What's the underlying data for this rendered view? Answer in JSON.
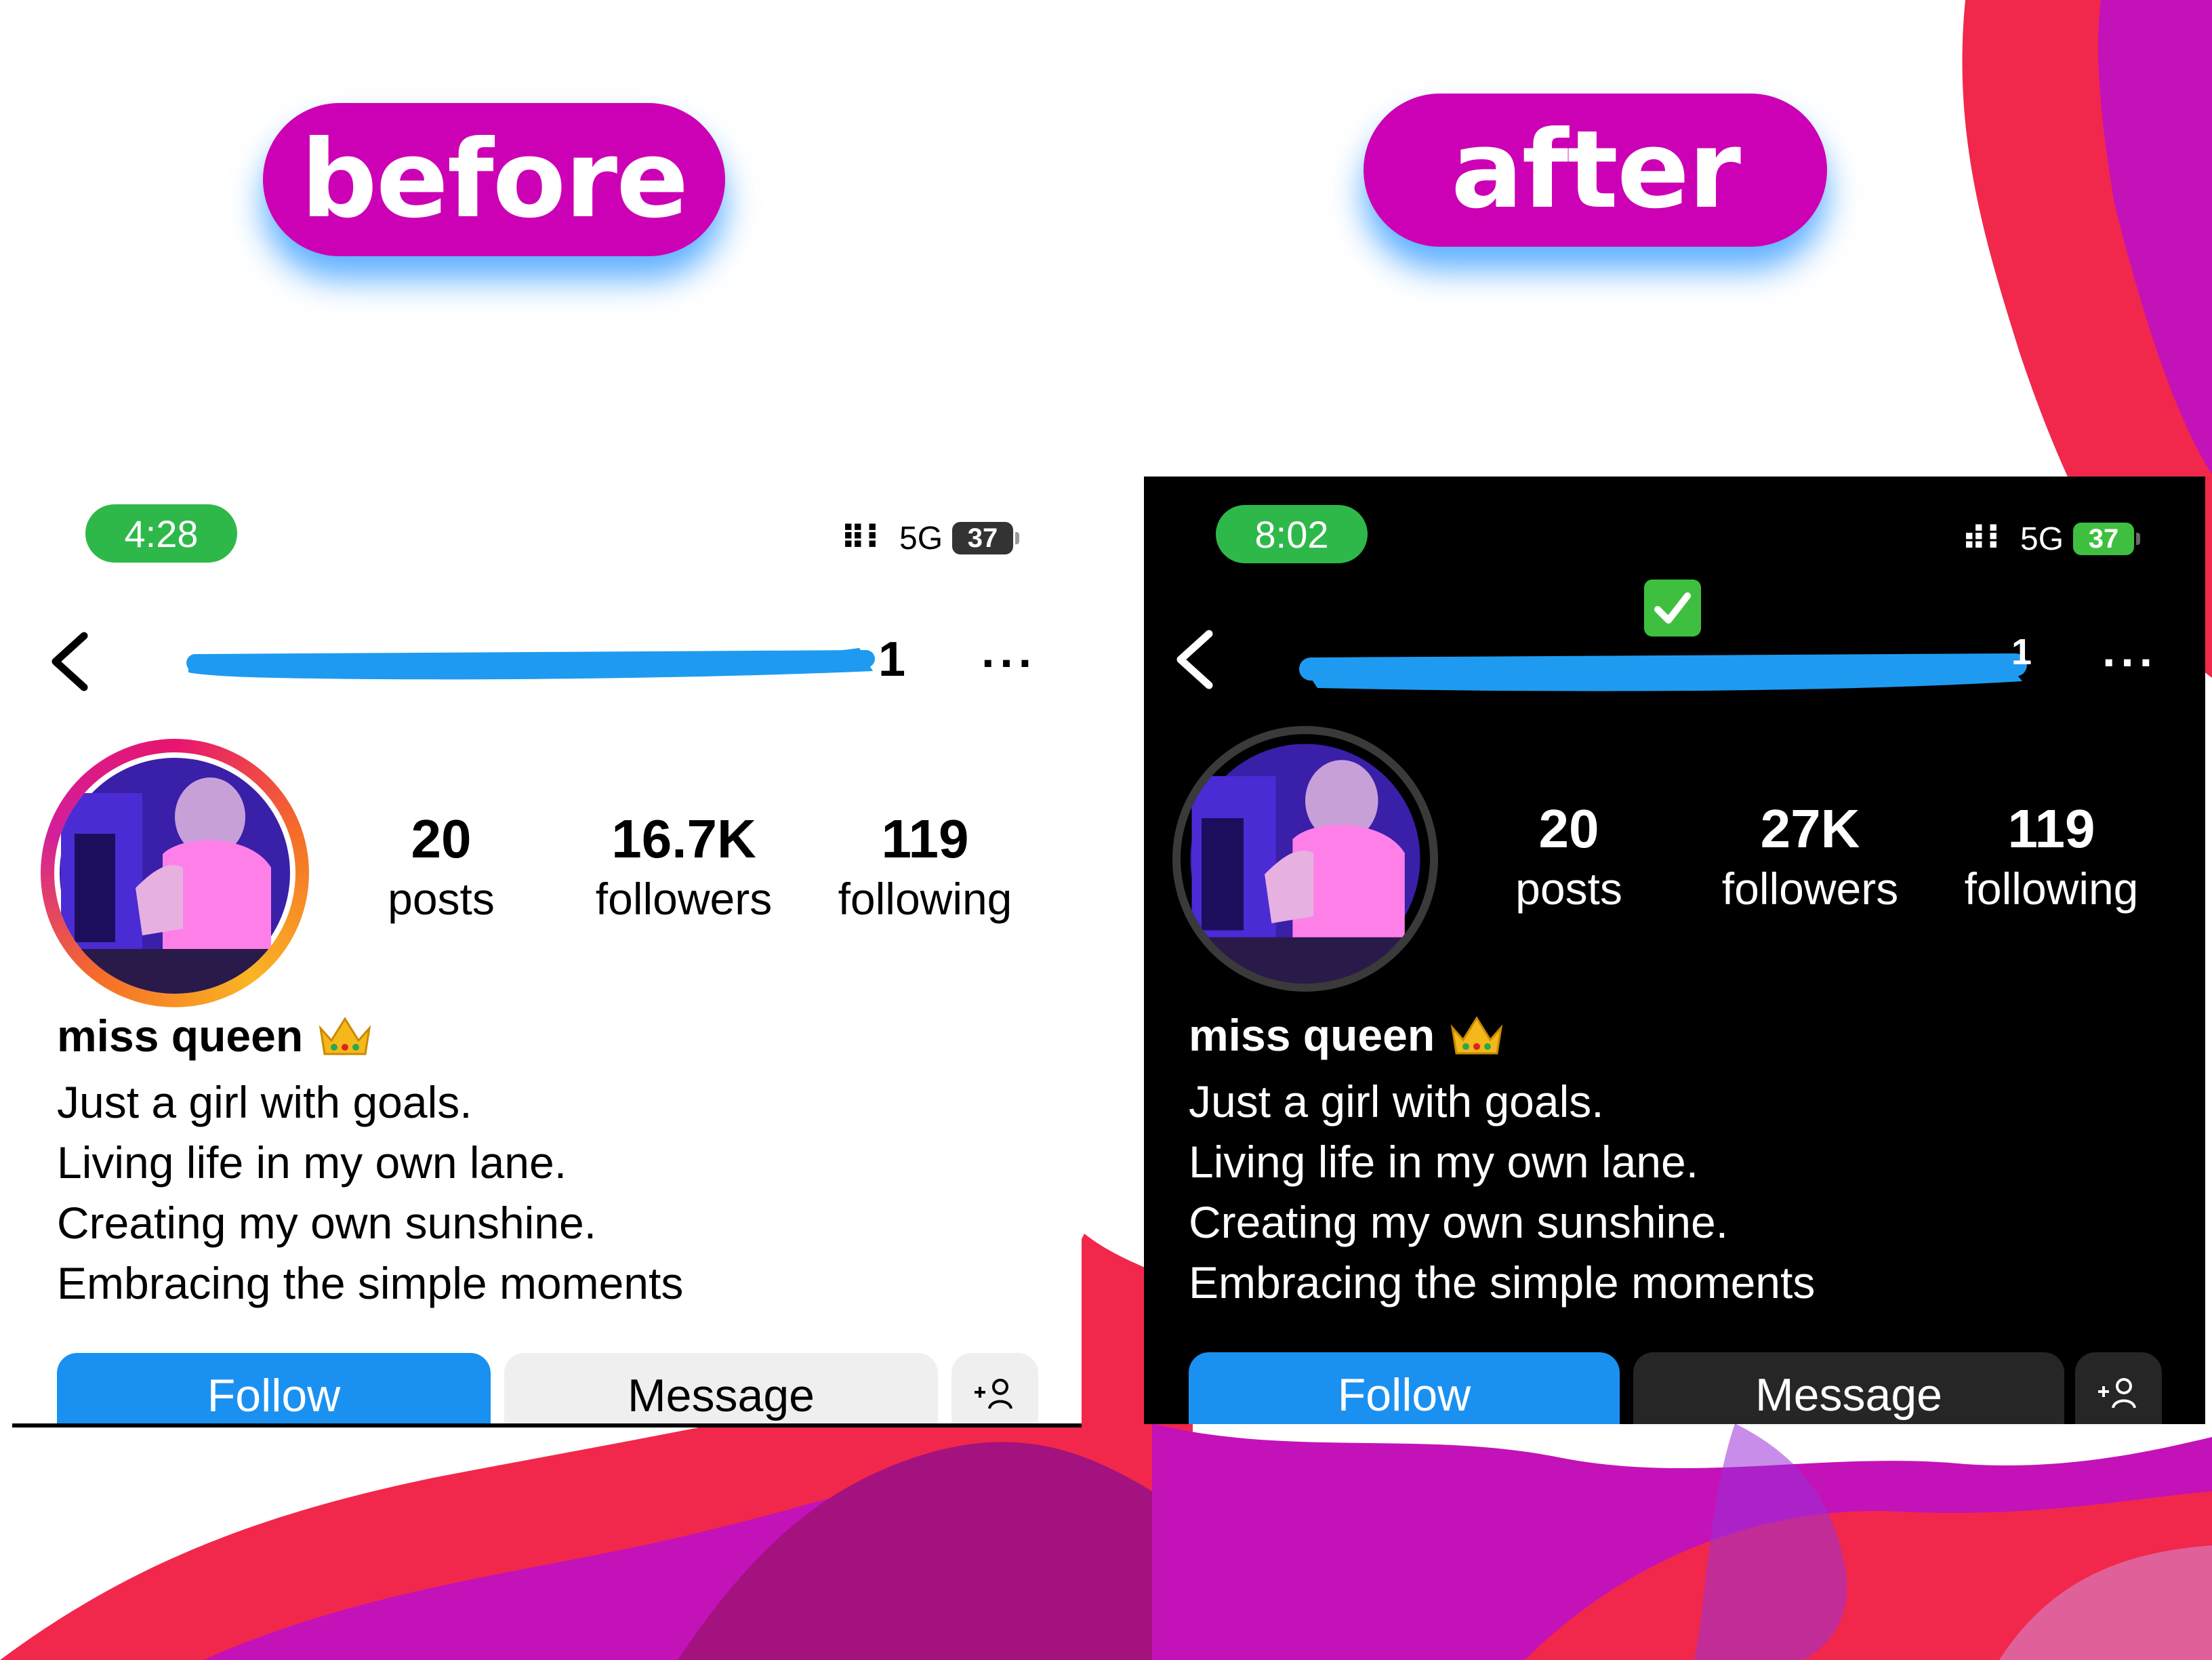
{
  "labels": {
    "before": "before",
    "after": "after"
  },
  "colors": {
    "pill": "#cc00b4",
    "status_green": "#2fb84a",
    "follow_blue": "#1a91f0",
    "scribble_blue": "#1e9bf0",
    "message_light": "#efefef",
    "message_dark": "#262626",
    "accent_pink": "#f1284b",
    "accent_magenta": "#c312b8"
  },
  "before": {
    "status": {
      "time": "4:28",
      "network": "5G",
      "battery": "37"
    },
    "header": {
      "handle_tail": "1",
      "more": "···"
    },
    "stats": [
      {
        "value": "20",
        "label": "posts"
      },
      {
        "value": "16.7K",
        "label": "followers"
      },
      {
        "value": "119",
        "label": "following"
      }
    ],
    "profile": {
      "name": "miss queen",
      "bio": [
        "Just a girl with goals.",
        "Living life in my own lane.",
        "Creating my own sunshine.",
        "Embracing the simple moments"
      ]
    },
    "buttons": {
      "follow": "Follow",
      "message": "Message",
      "add_person": "+2"
    }
  },
  "after": {
    "status": {
      "time": "8:02",
      "network": "5G",
      "battery": "37"
    },
    "header": {
      "handle_tail": "1",
      "more": "···"
    },
    "stats": [
      {
        "value": "20",
        "label": "posts"
      },
      {
        "value": "27K",
        "label": "followers"
      },
      {
        "value": "119",
        "label": "following"
      }
    ],
    "profile": {
      "name": "miss queen",
      "bio": [
        "Just a girl with goals.",
        "Living life in my own lane.",
        "Creating my own sunshine.",
        "Embracing the simple moments"
      ]
    },
    "buttons": {
      "follow": "Follow",
      "message": "Message"
    }
  }
}
